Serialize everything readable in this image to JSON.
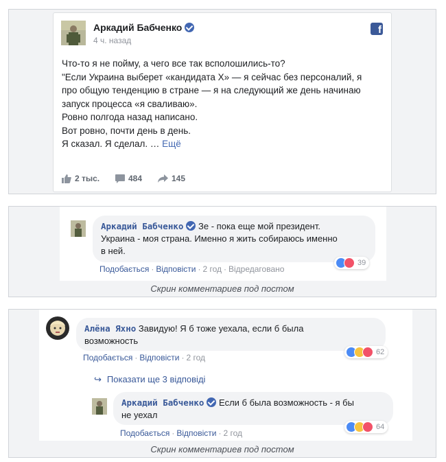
{
  "post": {
    "author": "Аркадий Бабченко",
    "time": "4 ч. назад",
    "lines": [
      "Что-то я не пойму, а чего все так всполошились-то?",
      "\"Если Украина выберет «кандидата Х» — я сейчас без персоналий, я",
      "про общую тенденцию в стране — я на следующий же день начинаю",
      "запуск процесса «я сваливаю».",
      "Ровно полгода назад написано.",
      "Вот ровно, почти день в день.",
      "Я сказал. Я сделал. …"
    ],
    "more": "Ещё",
    "likes": "2 тыс.",
    "comments": "484",
    "shares": "145",
    "icons": [
      "facebook-icon",
      "verified-icon",
      "like-icon",
      "comment-icon",
      "share-icon"
    ]
  },
  "comment1": {
    "author": "Аркадий Бабченко",
    "text1": "Зе - пока еще мой президент.",
    "text2": "Украина - моя страна. Именно я жить собираюсь именно",
    "text3": "в ней.",
    "like": "Подобається",
    "reply": "Відповісти",
    "time": "2 год",
    "edited": "Відредаговано",
    "count": "39",
    "caption": "Скрин комментариев под постом"
  },
  "comment2": {
    "author": "Алёна Яхно",
    "text1": "Завидую! Я б тоже уехала, если б была",
    "text2": "возможность",
    "like": "Подобається",
    "reply": "Відповісти",
    "time": "2 год",
    "count": "62",
    "more_replies": "Показати ще 3 відповіді"
  },
  "comment3": {
    "author": "Аркадий Бабченко",
    "text1": "Если б была возможность - я бы",
    "text2": "не уехал",
    "like": "Подобається",
    "reply": "Відповісти",
    "time": "2 год",
    "count": "64",
    "caption": "Скрин комментариев под постом"
  },
  "colors": {
    "link": "#385898",
    "brand": "#3b5998",
    "muted": "#90949c",
    "bubble": "#f2f3f5"
  }
}
